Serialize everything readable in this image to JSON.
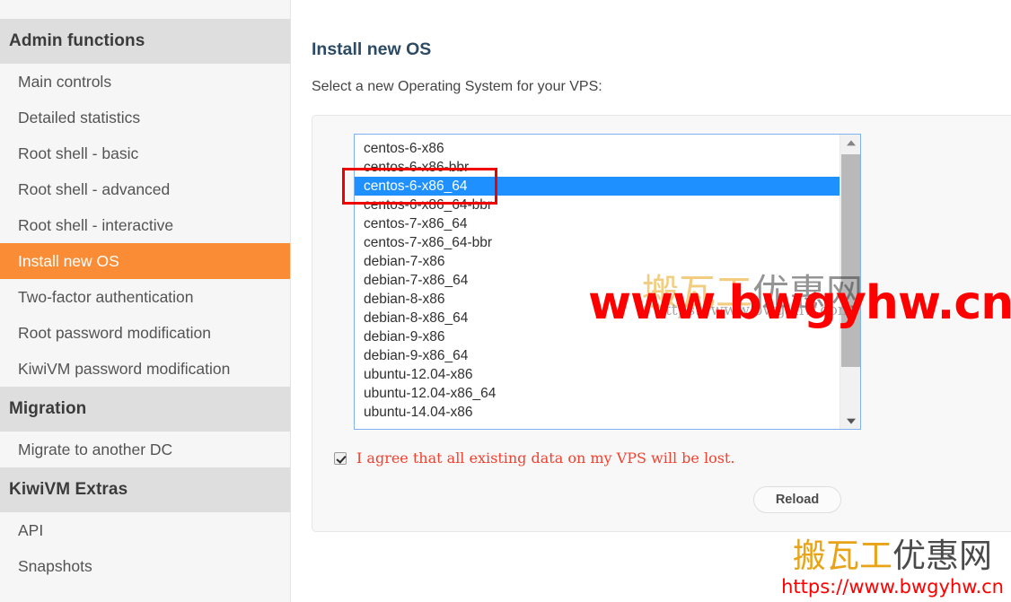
{
  "sidebar": {
    "sections": [
      {
        "header": "Admin functions",
        "items": [
          {
            "label": "Main controls",
            "active": false
          },
          {
            "label": "Detailed statistics",
            "active": false
          },
          {
            "label": "Root shell - basic",
            "active": false
          },
          {
            "label": "Root shell - advanced",
            "active": false
          },
          {
            "label": "Root shell - interactive",
            "active": false
          },
          {
            "label": "Install new OS",
            "active": true
          },
          {
            "label": "Two-factor authentication",
            "active": false
          },
          {
            "label": "Root password modification",
            "active": false
          },
          {
            "label": "KiwiVM password modification",
            "active": false
          }
        ]
      },
      {
        "header": "Migration",
        "items": [
          {
            "label": "Migrate to another DC",
            "active": false
          }
        ]
      },
      {
        "header": "KiwiVM Extras",
        "items": [
          {
            "label": "API",
            "active": false
          },
          {
            "label": "Snapshots",
            "active": false
          }
        ]
      }
    ]
  },
  "main": {
    "page_title": "Install new OS",
    "intro_text": "Select a new Operating System for your VPS:",
    "os_options": [
      "centos-6-x86",
      "centos-6-x86-bbr",
      "centos-6-x86_64",
      "centos-6-x86_64-bbr",
      "centos-7-x86_64",
      "centos-7-x86_64-bbr",
      "debian-7-x86",
      "debian-7-x86_64",
      "debian-8-x86",
      "debian-8-x86_64",
      "debian-9-x86",
      "debian-9-x86_64",
      "ubuntu-12.04-x86",
      "ubuntu-12.04-x86_64",
      "ubuntu-14.04-x86"
    ],
    "selected_os": "centos-6-x86_64",
    "agree_label": "I agree that all existing data on my VPS will be lost.",
    "agree_checked": true,
    "reload_label": "Reload"
  },
  "watermarks": {
    "center_big_url": "www.bwgyhw.cn",
    "center_faded_logo_part1": "搬瓦工",
    "center_faded_logo_part2": "优惠网",
    "center_faded_url": "https://www.bwgyhw.com",
    "corner_logo_part1": "搬瓦工",
    "corner_logo_part2": "优惠网",
    "corner_url": "https://www.bwgyhw.cn"
  },
  "colors": {
    "sidebar_active": "#fb8c36",
    "listbox_selection": "#1e90ff",
    "annotation": "#ee0000",
    "warning_text": "#f4402e",
    "title": "#2c4a63"
  }
}
